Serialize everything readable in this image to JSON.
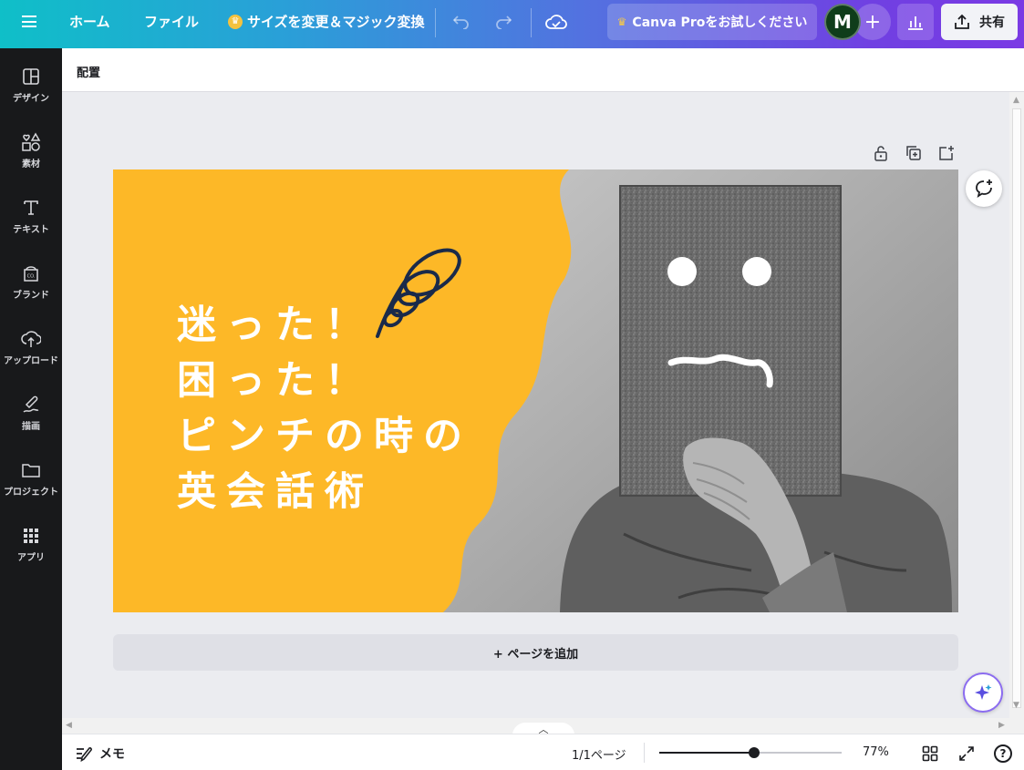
{
  "topbar": {
    "menu_icon": "hamburger-icon",
    "home": "ホーム",
    "file": "ファイル",
    "resize": "サイズを変更＆マジック変換",
    "pro_cta": "Canva Proをお試しください",
    "avatar_letter": "M",
    "share": "共有",
    "colors": {
      "gradient_start": "#0fbfc8",
      "gradient_end": "#7a3ae4",
      "avatar": "#0f3d1a"
    }
  },
  "sidebar": {
    "items": [
      {
        "label": "デザイン",
        "icon": "layout-icon"
      },
      {
        "label": "素材",
        "icon": "elements-icon"
      },
      {
        "label": "テキスト",
        "icon": "text-icon"
      },
      {
        "label": "ブランド",
        "icon": "brand-icon"
      },
      {
        "label": "アップロード",
        "icon": "upload-icon"
      },
      {
        "label": "描画",
        "icon": "draw-icon"
      },
      {
        "label": "プロジェクト",
        "icon": "folder-icon"
      },
      {
        "label": "アプリ",
        "icon": "apps-icon"
      }
    ]
  },
  "subbar": {
    "position_label": "配置"
  },
  "design": {
    "title_lines": [
      "迷った！",
      "困った！",
      "ピンチの時の",
      "英会話術"
    ],
    "background_color": "#fdb827"
  },
  "canvas": {
    "add_page": "+ ページを追加"
  },
  "bottombar": {
    "memo": "メモ",
    "page_count": "1/1ページ",
    "zoom": "77%",
    "zoom_fraction": 0.52
  }
}
